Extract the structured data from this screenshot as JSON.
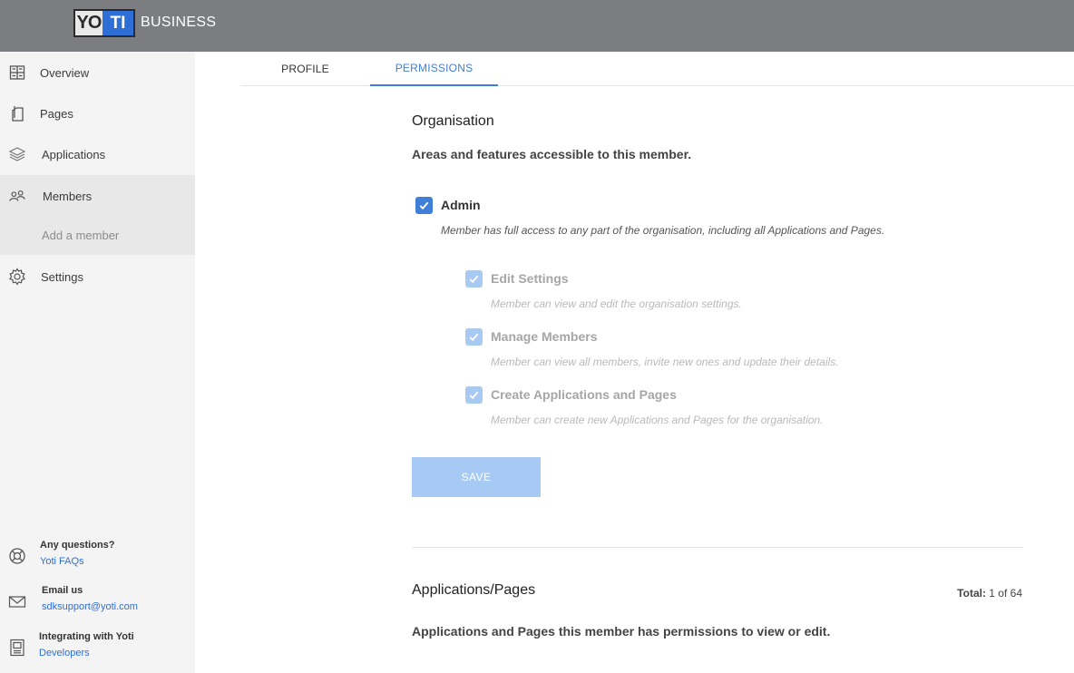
{
  "header": {
    "logo_left": "YO",
    "logo_right": "TI",
    "brand": "BUSINESS",
    "bar_color": "#7c7d80"
  },
  "sidebar": {
    "items": [
      {
        "label": "Overview",
        "icon": "grid-icon"
      },
      {
        "label": "Pages",
        "icon": "pages-icon"
      },
      {
        "label": "Applications",
        "icon": "layers-icon"
      },
      {
        "label": "Members",
        "icon": "members-icon",
        "active": true
      },
      {
        "label": "Settings",
        "icon": "gear-icon"
      }
    ],
    "sub_item": "Add a member",
    "help": [
      {
        "title": "Any questions?",
        "link": "Yoti FAQs",
        "icon": "lifebuoy-icon"
      },
      {
        "title": "Email us",
        "link": "sdksupport@yoti.com",
        "icon": "mail-icon"
      },
      {
        "title": "Integrating with Yoti",
        "link": "Developers",
        "icon": "document-icon"
      }
    ]
  },
  "tabs": [
    {
      "label": "PROFILE",
      "active": false
    },
    {
      "label": "PERMISSIONS",
      "active": true
    }
  ],
  "organisation": {
    "title": "Organisation",
    "subtitle": "Areas and features accessible to this member.",
    "permissions": [
      {
        "label": "Admin",
        "description": "Member has full access to any part of the organisation, including all Applications and Pages.",
        "checked": true,
        "disabled": false
      },
      {
        "label": "Edit Settings",
        "description": "Member can view and edit the organisation settings.",
        "checked": true,
        "disabled": true
      },
      {
        "label": "Manage Members",
        "description": "Member can view all members, invite new ones and update their details.",
        "checked": true,
        "disabled": true
      },
      {
        "label": "Create Applications and Pages",
        "description": "Member can create new Applications and Pages for the organisation.",
        "checked": true,
        "disabled": true
      }
    ],
    "save_label": "SAVE"
  },
  "applications": {
    "title": "Applications/Pages",
    "total_label": "Total:",
    "total_value": "1 of 64",
    "subtitle": "Applications and Pages this member has permissions to view or edit."
  },
  "colors": {
    "accent": "#3f7fd8",
    "disabled_accent": "#a8c9f2",
    "sidebar_bg": "#f4f4f4"
  }
}
